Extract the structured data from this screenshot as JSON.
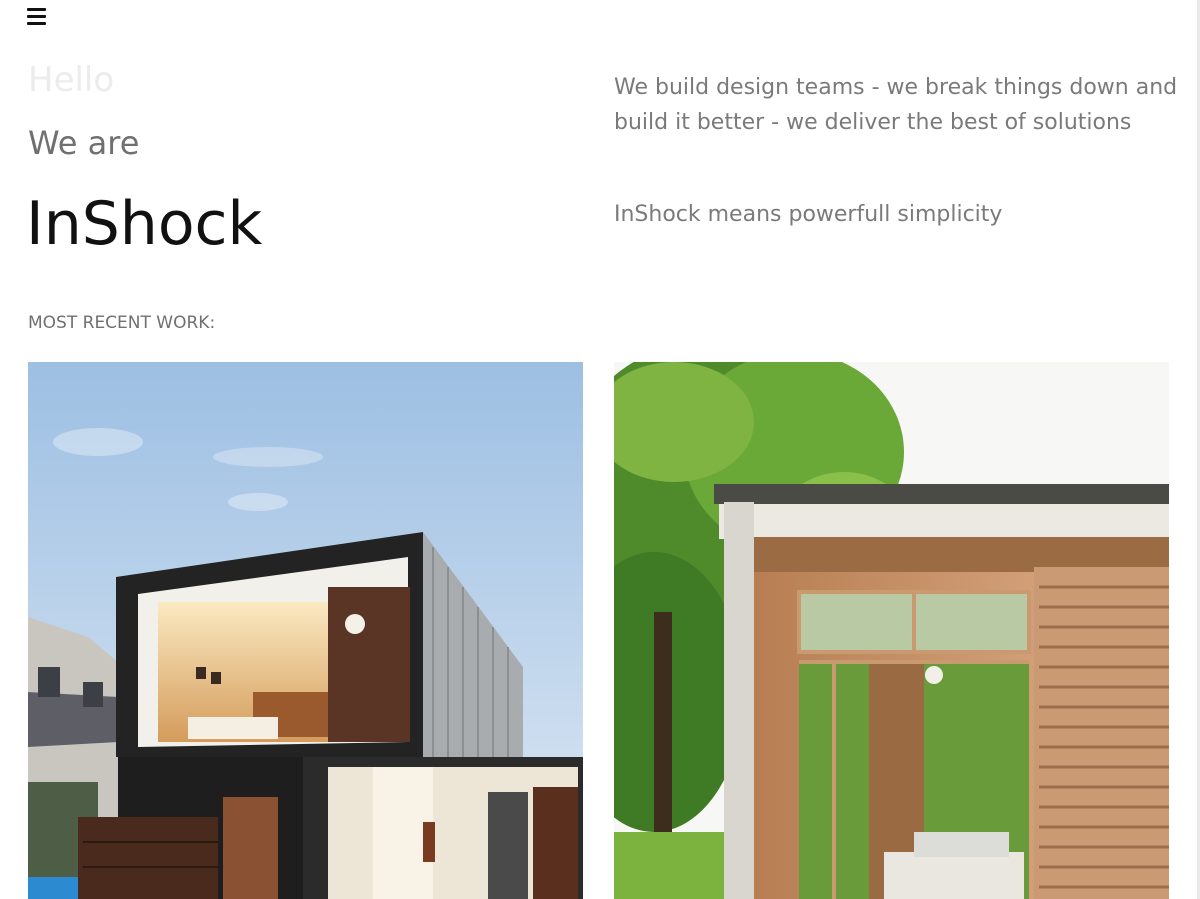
{
  "header": {
    "menu_icon": "hamburger-menu-icon"
  },
  "hero": {
    "greeting": "Hello",
    "lead": "We are",
    "brand": "InShock",
    "intro": "We build design teams - we break things down and build it better - we deliver the best of solutions",
    "tagline": "InShock means powerfull simplicity"
  },
  "work": {
    "heading": "MOST RECENT WORK:",
    "items": [
      {
        "image": "modern-house-dusk-photo"
      },
      {
        "image": "garden-pavilion-bedroom-photo"
      }
    ]
  },
  "colors": {
    "text_dark": "#111111",
    "text_muted": "#707070",
    "text_faint": "#ececec"
  }
}
